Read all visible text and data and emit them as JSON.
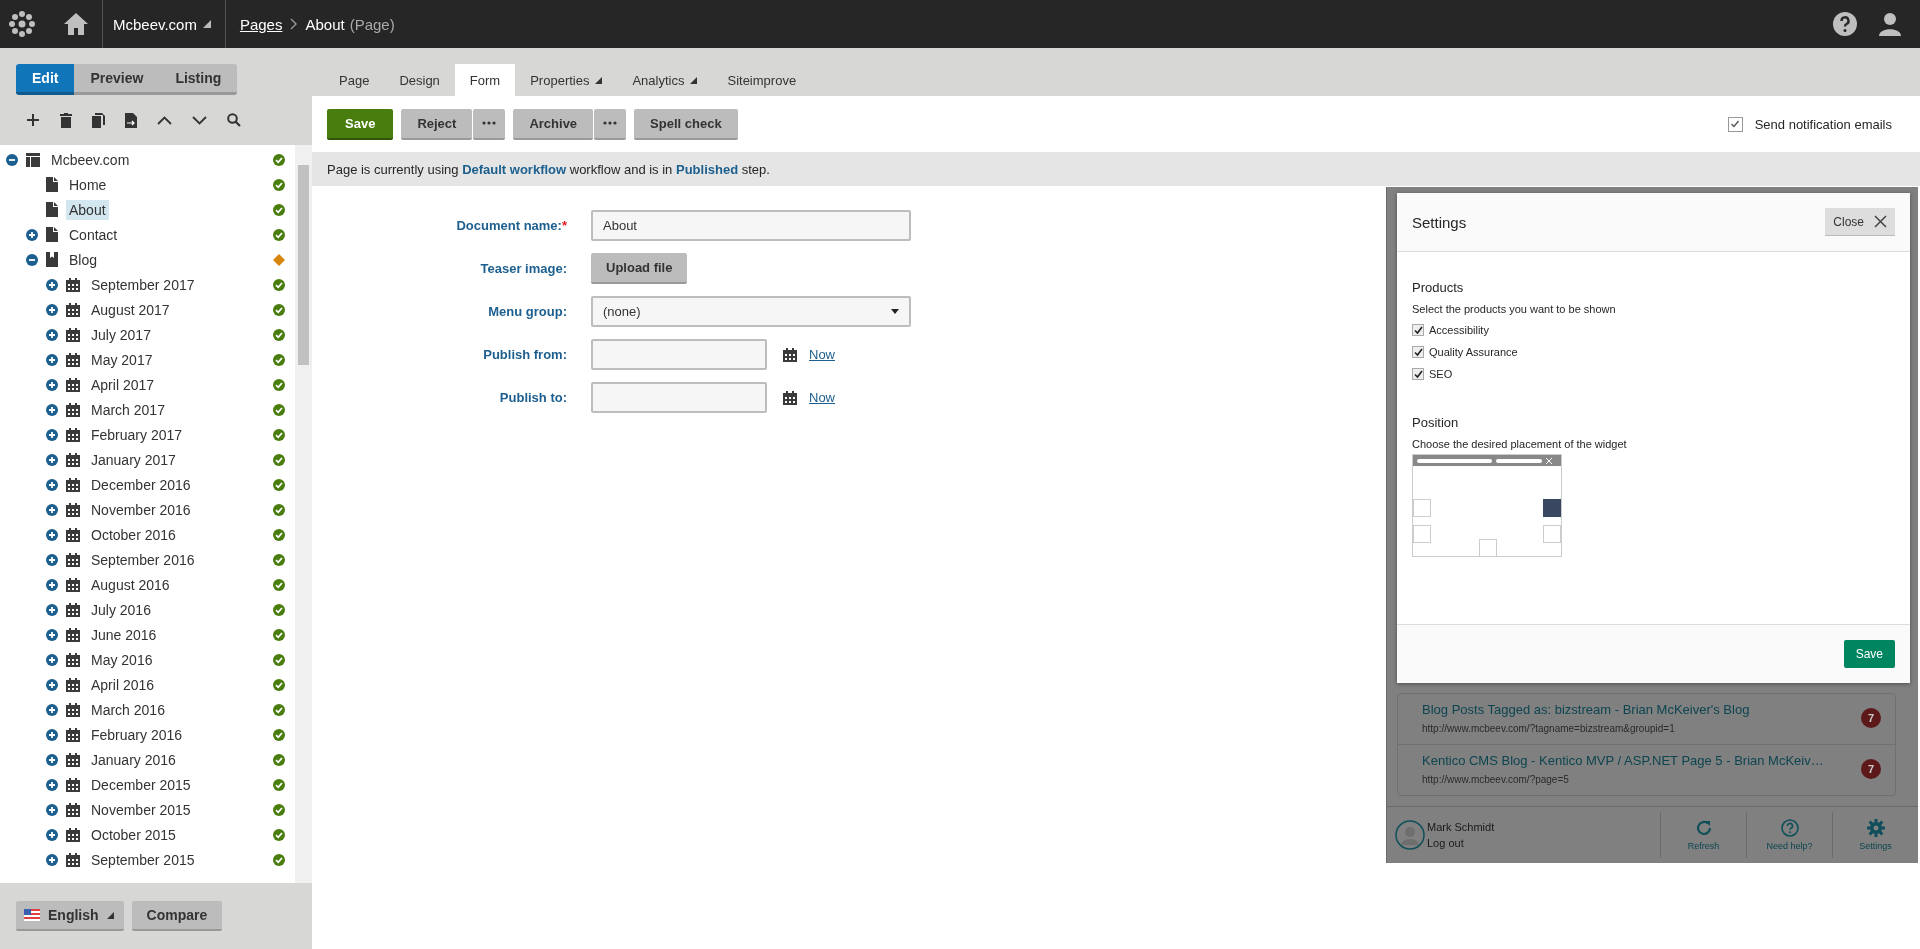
{
  "topbar": {
    "site": "Mcbeev.com",
    "breadcrumb_link": "Pages",
    "breadcrumb_current": "About",
    "breadcrumb_suffix": "(Page)"
  },
  "mode_tabs": [
    {
      "label": "Edit",
      "selected": true
    },
    {
      "label": "Preview",
      "selected": false
    },
    {
      "label": "Listing",
      "selected": false
    }
  ],
  "tree": [
    {
      "label": "Mcbeev.com",
      "kind": "site",
      "published": true,
      "expanded": true,
      "selected": false,
      "children": [
        {
          "label": "Home",
          "kind": "page",
          "published": true,
          "selected": false
        },
        {
          "label": "About",
          "kind": "page",
          "published": true,
          "selected": true
        },
        {
          "label": "Contact",
          "kind": "page",
          "published": true,
          "expanded": false,
          "selected": false
        },
        {
          "label": "Blog",
          "kind": "blog",
          "published": false,
          "expanded": true,
          "selected": false,
          "children": [
            {
              "label": "September 2017",
              "kind": "month",
              "published": true,
              "expanded": false,
              "selected": false
            },
            {
              "label": "August 2017",
              "kind": "month",
              "published": true,
              "expanded": false,
              "selected": false
            },
            {
              "label": "July 2017",
              "kind": "month",
              "published": true,
              "expanded": false,
              "selected": false
            },
            {
              "label": "May 2017",
              "kind": "month",
              "published": true,
              "expanded": false,
              "selected": false
            },
            {
              "label": "April 2017",
              "kind": "month",
              "published": true,
              "expanded": false,
              "selected": false
            },
            {
              "label": "March 2017",
              "kind": "month",
              "published": true,
              "expanded": false,
              "selected": false
            },
            {
              "label": "February 2017",
              "kind": "month",
              "published": true,
              "expanded": false,
              "selected": false
            },
            {
              "label": "January 2017",
              "kind": "month",
              "published": true,
              "expanded": false,
              "selected": false
            },
            {
              "label": "December 2016",
              "kind": "month",
              "published": true,
              "expanded": false,
              "selected": false
            },
            {
              "label": "November 2016",
              "kind": "month",
              "published": true,
              "expanded": false,
              "selected": false
            },
            {
              "label": "October 2016",
              "kind": "month",
              "published": true,
              "expanded": false,
              "selected": false
            },
            {
              "label": "September 2016",
              "kind": "month",
              "published": true,
              "expanded": false,
              "selected": false
            },
            {
              "label": "August 2016",
              "kind": "month",
              "published": true,
              "expanded": false,
              "selected": false
            },
            {
              "label": "July 2016",
              "kind": "month",
              "published": true,
              "expanded": false,
              "selected": false
            },
            {
              "label": "June 2016",
              "kind": "month",
              "published": true,
              "expanded": false,
              "selected": false
            },
            {
              "label": "May 2016",
              "kind": "month",
              "published": true,
              "expanded": false,
              "selected": false
            },
            {
              "label": "April 2016",
              "kind": "month",
              "published": true,
              "expanded": false,
              "selected": false
            },
            {
              "label": "March 2016",
              "kind": "month",
              "published": true,
              "expanded": false,
              "selected": false
            },
            {
              "label": "February 2016",
              "kind": "month",
              "published": true,
              "expanded": false,
              "selected": false
            },
            {
              "label": "January 2016",
              "kind": "month",
              "published": true,
              "expanded": false,
              "selected": false
            },
            {
              "label": "December 2015",
              "kind": "month",
              "published": true,
              "expanded": false,
              "selected": false
            },
            {
              "label": "November 2015",
              "kind": "month",
              "published": true,
              "expanded": false,
              "selected": false
            },
            {
              "label": "October 2015",
              "kind": "month",
              "published": true,
              "expanded": false,
              "selected": false
            },
            {
              "label": "September 2015",
              "kind": "month",
              "published": true,
              "expanded": false,
              "selected": false
            }
          ]
        }
      ]
    }
  ],
  "left_footer": {
    "language": "English",
    "compare": "Compare"
  },
  "tabs": [
    {
      "label": "Page",
      "selected": false,
      "dropdown": false
    },
    {
      "label": "Design",
      "selected": false,
      "dropdown": false
    },
    {
      "label": "Form",
      "selected": true,
      "dropdown": false
    },
    {
      "label": "Properties",
      "selected": false,
      "dropdown": true
    },
    {
      "label": "Analytics",
      "selected": false,
      "dropdown": true
    },
    {
      "label": "Siteimprove",
      "selected": false,
      "dropdown": false
    }
  ],
  "toolbar": [
    {
      "label": "Save",
      "kind": "primary"
    },
    {
      "label": "Reject",
      "kind": "split"
    },
    {
      "label": "Archive",
      "kind": "split"
    },
    {
      "label": "Spell check",
      "kind": "plain"
    }
  ],
  "notify": {
    "label": "Send notification emails",
    "checked": true
  },
  "workflow_message": "Page is currently using **Default workflow** workflow and is in **Published** step.",
  "form": [
    {
      "label": "Document name:",
      "required_mark": "*",
      "kind": "text",
      "value": "About"
    },
    {
      "label": "Teaser image:",
      "kind": "upload",
      "button": "Upload file"
    },
    {
      "label": "Menu group:",
      "kind": "select",
      "value": "(none)"
    },
    {
      "label": "Publish from:",
      "kind": "date",
      "link": "Now"
    },
    {
      "label": "Publish to:",
      "kind": "date",
      "link": "Now"
    }
  ],
  "widget": {
    "dialog": {
      "title": "Settings",
      "close": "Close",
      "products_heading": "Products",
      "products_hint": "Select the products you want to be shown",
      "products": [
        {
          "label": "Accessibility",
          "checked": true
        },
        {
          "label": "Quality Assurance",
          "checked": true
        },
        {
          "label": "SEO",
          "checked": true
        }
      ],
      "position_heading": "Position",
      "position_hint": "Choose the desired placement of the widget",
      "positions": [
        {
          "kind": "left-middle",
          "selected": false
        },
        {
          "kind": "right-middle",
          "selected": true
        },
        {
          "kind": "left-bottom",
          "selected": false
        },
        {
          "kind": "bottom-center",
          "selected": false
        },
        {
          "kind": "right-bottom",
          "selected": false
        }
      ],
      "save": "Save"
    },
    "results": [
      {
        "title": "Blog Posts Tagged as: bizstream - Brian McKeiver's Blog",
        "url": "http://www.mcbeev.com/?tagname=bizstream&groupid=1",
        "count": "7"
      },
      {
        "title": "Kentico CMS Blog - Kentico MVP / ASP.NET Page 5 - Brian McKeiv…",
        "url": "http://www.mcbeev.com/?page=5",
        "count": "7"
      }
    ],
    "user": "Mark Schmidt",
    "logout": "Log out",
    "actions": [
      {
        "label": "Refresh",
        "kind": "refresh"
      },
      {
        "label": "Need help?",
        "kind": "help"
      },
      {
        "label": "Settings",
        "kind": "settings"
      }
    ]
  }
}
